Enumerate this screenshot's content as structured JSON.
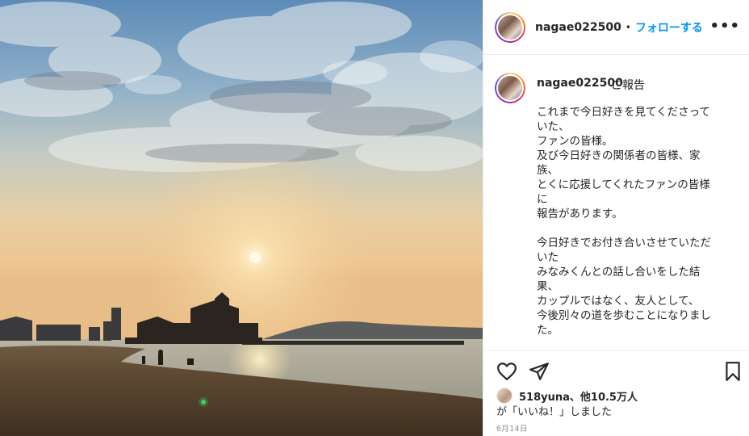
{
  "post": {
    "username": "nagae022500",
    "follow_separator": "•",
    "follow_label": "フォローする",
    "more_label": "•••",
    "caption_title": "ご報告",
    "caption_lines": [
      "これまで今日好きを見てくださって",
      "いた、",
      "ファンの皆様。",
      "及び今日好きの関係者の皆様、家",
      "族、",
      "とくに応援してくれたファンの皆様",
      "に",
      "報告があります。",
      "",
      "今日好きでお付き合いさせていただ",
      "いた",
      "みなみくんとの話し合いをした結",
      "果、",
      "カップルではなく、友人として、",
      "今後別々の道を歩むことになりまし",
      "た。"
    ],
    "likes_line1": "518yuna、他10.5万人",
    "likes_line2": "が「いいね！」しました",
    "date": "6月14日"
  },
  "icons": {
    "like": "heart-icon",
    "share": "paper-plane-icon",
    "save": "bookmark-icon",
    "more": "more-dots-icon"
  },
  "colors": {
    "follow": "#0095f6",
    "text": "#262626",
    "muted": "#8e8e8e",
    "divider": "#efefef"
  }
}
